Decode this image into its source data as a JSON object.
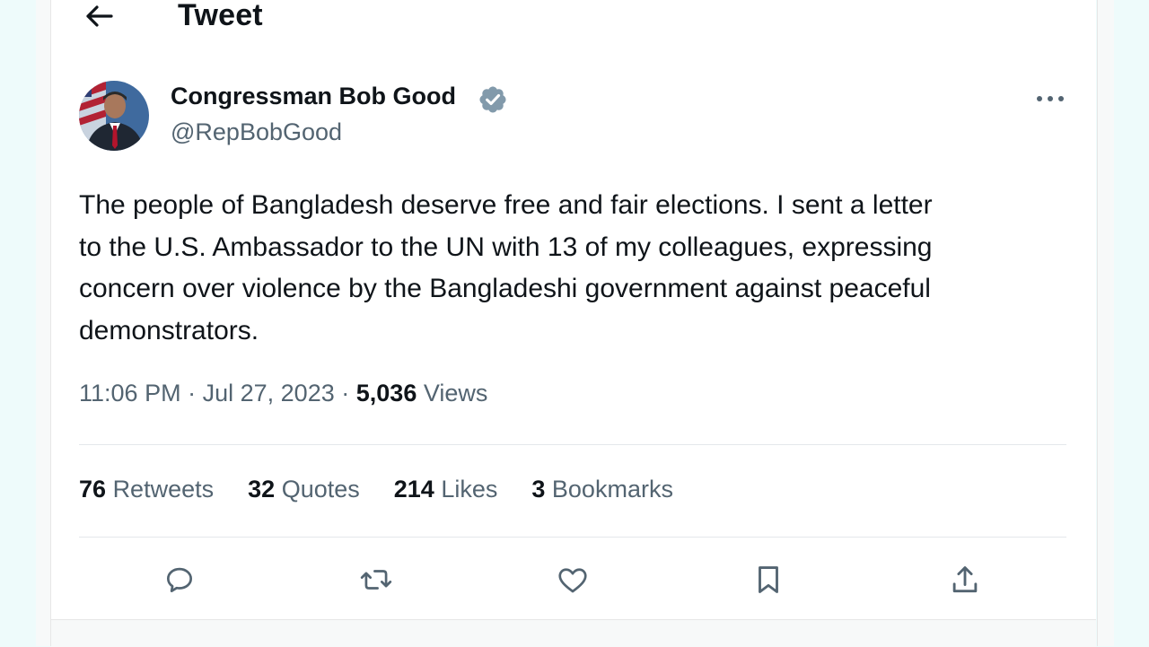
{
  "header": {
    "title": "Tweet"
  },
  "author": {
    "display_name": "Congressman Bob Good",
    "handle": "@RepBobGood",
    "verified": true
  },
  "tweet": {
    "lines": [
      "The people of Bangladesh deserve free and fair elections. I sent a letter",
      "to the U.S. Ambassador to the UN with 13 of my colleagues, expressing",
      "concern over violence by the Bangladeshi government against peaceful",
      "demonstrators."
    ],
    "time": "11:06 PM",
    "date": "Jul 27, 2023",
    "views_count": "5,036",
    "views_label": "Views",
    "separator": "·"
  },
  "stats": [
    {
      "count": "76",
      "label": "Retweets"
    },
    {
      "count": "32",
      "label": "Quotes"
    },
    {
      "count": "214",
      "label": "Likes"
    },
    {
      "count": "3",
      "label": "Bookmarks"
    }
  ],
  "actions": [
    "reply-icon",
    "retweet-icon",
    "like-icon",
    "bookmark-icon",
    "share-icon"
  ],
  "colors": {
    "text": "#0f1419",
    "secondary": "#536471",
    "divider": "#e4e8eb",
    "verified_badge": "#829aab"
  }
}
